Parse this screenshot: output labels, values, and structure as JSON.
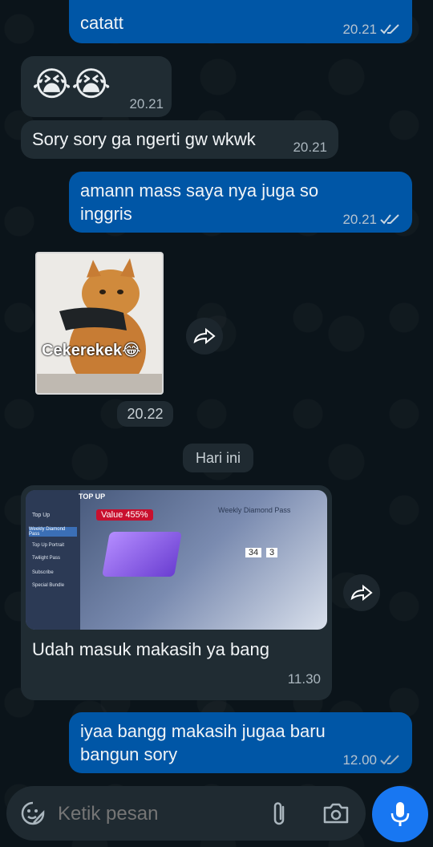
{
  "messages": [
    {
      "text": "catatt",
      "time": "20.21"
    },
    {
      "emoji": "😭😭",
      "time": "20.21"
    },
    {
      "text": "Sory sory ga ngerti gw wkwk",
      "time": "20.21"
    },
    {
      "text": "amann mass saya nya juga so inggris",
      "time": "20.21"
    },
    {
      "sticker_caption": "Cekerekek😂",
      "time": "20.22"
    },
    {
      "text": "Udah masuk makasih ya bang",
      "time": "11.30"
    },
    {
      "text": "iyaa bangg makasih jugaa baru bangun sory",
      "time": "12.00"
    }
  ],
  "date_divider": "Hari ini",
  "screenshot": {
    "top_up": "TOP UP",
    "value": "Value",
    "percent": "455%",
    "menu": [
      "Top Up",
      "Weekly Diamond Pass",
      "Top Up Portrait",
      "Twilight Pass",
      "Subscribe",
      "Special Bundle"
    ],
    "panel_title": "Weekly Diamond Pass",
    "count_a": "34",
    "count_b": "3"
  },
  "input": {
    "placeholder": "Ketik pesan"
  },
  "icons": [
    "sticker-icon",
    "attach-icon",
    "camera-icon",
    "mic-icon",
    "forward-icon",
    "double-check-icon"
  ],
  "colors": {
    "outgoing": "#0056a6",
    "incoming": "#202c33",
    "accent": "#1877f2"
  }
}
